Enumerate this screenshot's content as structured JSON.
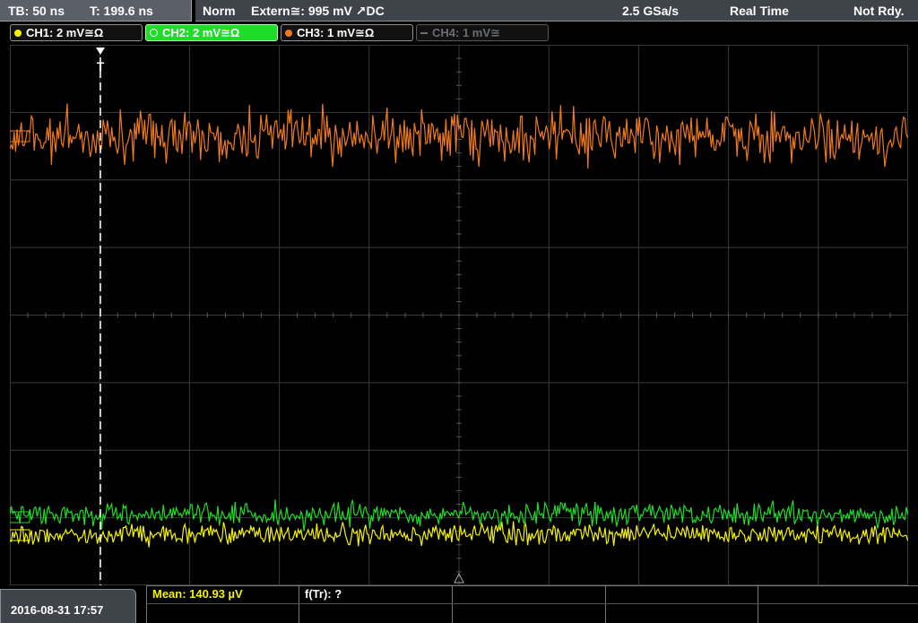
{
  "topbar": {
    "timebase": "TB: 50 ns",
    "trigger_time": "T: 199.6 ns",
    "trigger_mode": "Norm",
    "trigger_source": "Extern≅: 995 mV ↗DC",
    "sample_rate": "2.5 GSa/s",
    "acq_mode": "Real Time",
    "trigger_status": "Not Rdy."
  },
  "channels": [
    {
      "label": "CH1: 2 mV≅Ω",
      "color": "#f5f300",
      "active": true
    },
    {
      "label": "CH2: 2 mV≅Ω",
      "color": "#1edc27",
      "active": true,
      "selected": true
    },
    {
      "label": "CH3: 1 mV≅Ω",
      "color": "#f07a1a",
      "active": true
    },
    {
      "label": "CH4: 1 mV≅",
      "color": "#6a6e74",
      "active": false
    }
  ],
  "screen": {
    "trigger_marker_label": "T",
    "divisions": {
      "x": 10,
      "y": 8
    },
    "colors": {
      "ch1": "#f5f300",
      "ch2": "#1edc27",
      "ch3": "#f07a1a",
      "grid": "#3a3a3a"
    }
  },
  "bottom": {
    "datetime": "2016-08-31 17:57",
    "measurement_mean": "Mean: 140.93 µV",
    "measurement_ftr": "f(Tr): ?"
  }
}
